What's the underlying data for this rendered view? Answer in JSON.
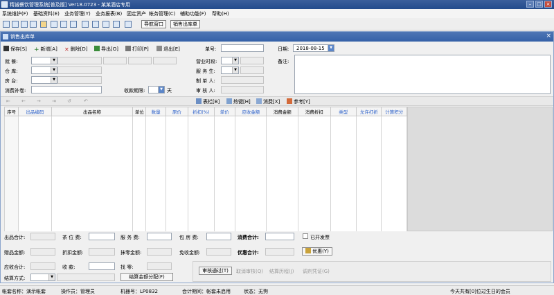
{
  "window": {
    "title": "精诚餐饮管理系统[普及版] Ver18.0723 - 某某酒店专用"
  },
  "menu": [
    "系统维护(F)",
    "基础资料(E)",
    "业务管理(Y)",
    "业务报表(B)",
    "固定资产",
    "帐务管理(C)",
    "辅助功能(F)",
    "帮助(H)"
  ],
  "toolbar": {
    "nav_window": "导航窗口",
    "sales_out": "销售出库单"
  },
  "child": {
    "title": "销售出库单",
    "buttons": {
      "save": "保存[S]",
      "add": "新增[A]",
      "delete": "删除[D]",
      "export": "导出[O]",
      "print": "打印[P]",
      "exit": "退出[E]"
    },
    "doc_no_label": "单号:",
    "date_label": "日期:",
    "date_value": "2018-08-15"
  },
  "form": {
    "dining_label": "就  餐:",
    "warehouse_label": "仓  库:",
    "room_label": "房  台:",
    "consume_label": "消费补卷:",
    "collect_label": "收款期限:",
    "collect_unit": "天",
    "period_label": "营业时段:",
    "waiter_label": "服 务 生:",
    "maker_label": "制 单 人:",
    "auditor_label": "审 核 人:",
    "remark_label": "备注:"
  },
  "sub_toolbar": {
    "table_bar": "表栏[B]",
    "hotkey": "热键[H]",
    "consume": "消费[X]",
    "reference": "参考[Y]"
  },
  "columns": [
    "序号",
    "出品编码",
    "出品名称",
    "单位",
    "数量",
    "原价",
    "折扣(%)",
    "单价",
    "应收金额",
    "消费金额",
    "消费折扣",
    "类型",
    "允许打折",
    "计算积分"
  ],
  "summary": {
    "item_total": "出品合计:",
    "tea_fee": "茶 位 费:",
    "service_fee": "服 务 费:",
    "room_fee": "包 房 费:",
    "consume_total": "消费合计:",
    "invoice": "已开发票",
    "gift_amount": "赠品金额:",
    "discount_amount": "折扣金额:",
    "zero_amount": "抹零金额:",
    "free_amount": "免收金额:",
    "preferential_total": "优惠合计:",
    "preferential_btn": "优惠(Y)",
    "receivable_total": "应收合计:",
    "received": "收    款:",
    "change": "找    零:",
    "settle_mode": "结算方式:",
    "settle_alloc": "结算金额分配(F)",
    "audit_pass": "审核通过(T)",
    "cancel_audit": "取消审核(Q)",
    "settle_history": "结算历程(J)",
    "adjust": "调剂凭证(G)"
  },
  "status": {
    "account": "帐套名称：演示帐套",
    "operator": "操作员：管理员",
    "machine": "机器号：LP0832",
    "period": "会计期间：帐套未启用",
    "state": "状态：无狗",
    "birthday": "今天共有[0]位过生日的会员"
  }
}
